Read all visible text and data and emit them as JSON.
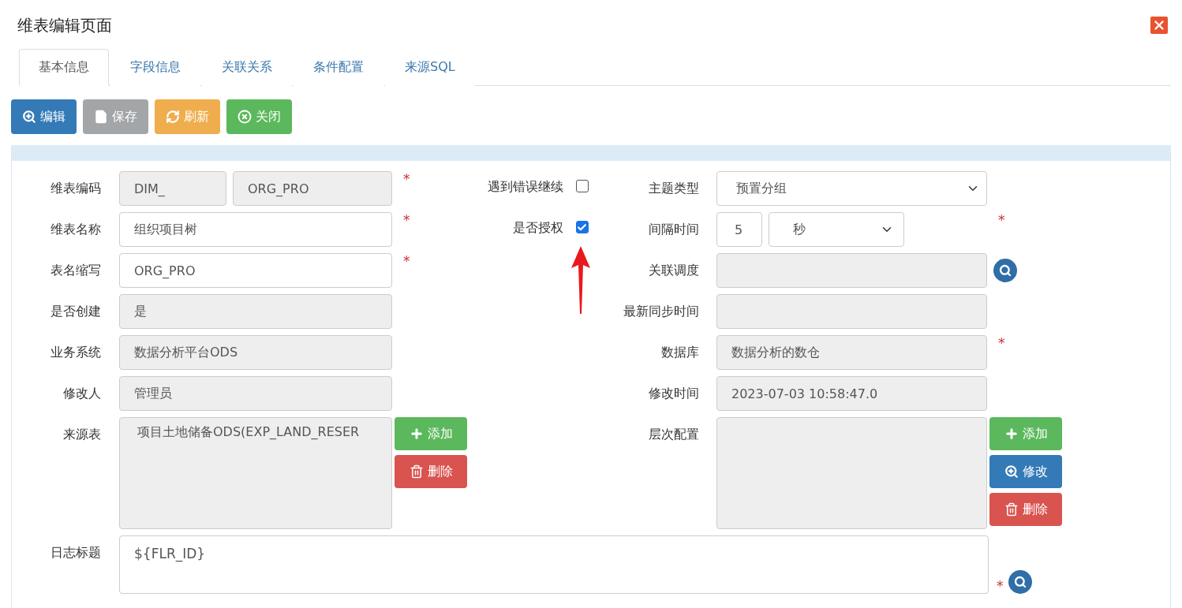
{
  "window": {
    "title": "维表编辑页面"
  },
  "tabs": [
    {
      "label": "基本信息",
      "selected": true
    },
    {
      "label": "字段信息",
      "selected": false
    },
    {
      "label": "关联关系",
      "selected": false
    },
    {
      "label": "条件配置",
      "selected": false
    },
    {
      "label": "来源SQL",
      "selected": false
    }
  ],
  "toolbar": [
    {
      "label": "编辑",
      "kind": "edit",
      "disabled": false
    },
    {
      "label": "保存",
      "kind": "save",
      "disabled": true
    },
    {
      "label": "刷新",
      "kind": "refresh",
      "disabled": false
    },
    {
      "label": "关闭",
      "kind": "close",
      "disabled": false
    }
  ],
  "form": {
    "rows": [
      {
        "left": {
          "label": "维表编码",
          "kind": "split",
          "values": [
            "DIM_",
            "ORG_PRO"
          ],
          "readonly": true,
          "required": true
        },
        "middle": {
          "label": "遇到错误继续",
          "checked": false
        },
        "right": {
          "label": "主题类型",
          "kind": "select",
          "value": "预置分组",
          "readonly": false,
          "required": false
        }
      },
      {
        "left": {
          "label": "维表名称",
          "kind": "text",
          "value": "组织项目树",
          "readonly": false,
          "required": true
        },
        "middle": {
          "label": "是否授权",
          "checked": true
        },
        "right": {
          "label": "间隔时间",
          "kind": "number-select",
          "value": "5",
          "unit": "秒",
          "readonly": false,
          "required": true
        }
      },
      {
        "left": {
          "label": "表名缩写",
          "kind": "text",
          "value": "ORG_PRO",
          "readonly": false,
          "required": true
        },
        "right": {
          "label": "关联调度",
          "kind": "lookup",
          "readonly": true,
          "required": false
        }
      },
      {
        "left": {
          "label": "是否创建",
          "kind": "text",
          "value": "是",
          "readonly": true,
          "required": false
        },
        "right": {
          "label": "最新同步时间",
          "kind": "text",
          "readonly": true,
          "required": false
        }
      },
      {
        "left": {
          "label": "业务系统",
          "kind": "text",
          "value": "数据分析平台ODS",
          "readonly": true,
          "required": false
        },
        "right": {
          "label": "数据库",
          "kind": "text",
          "value": "数据分析的数仓",
          "readonly": true,
          "required": true
        }
      },
      {
        "left": {
          "label": "修改人",
          "kind": "text",
          "value": "管理员",
          "readonly": true,
          "required": false
        },
        "right": {
          "label": "修改时间",
          "kind": "text",
          "value": "2023-07-03 10:58:47.0",
          "readonly": true,
          "required": false
        }
      },
      {
        "left": {
          "label": "来源表",
          "kind": "list",
          "items": [
            "项目土地储备ODS(EXP_LAND_RESER"
          ],
          "readonly": true,
          "required": false,
          "buttons": [
            {
              "label": "添加",
              "kind": "add"
            },
            {
              "label": "删除",
              "kind": "delete"
            }
          ]
        },
        "right": {
          "label": "层次配置",
          "kind": "list",
          "readonly": true,
          "required": false,
          "buttons": [
            {
              "label": "添加",
              "kind": "add"
            },
            {
              "label": "修改",
              "kind": "edit"
            },
            {
              "label": "删除",
              "kind": "delete"
            }
          ]
        }
      }
    ],
    "required_mark": "*",
    "log": {
      "label": "日志标题",
      "value": "${FLR_ID}",
      "required": true
    }
  }
}
